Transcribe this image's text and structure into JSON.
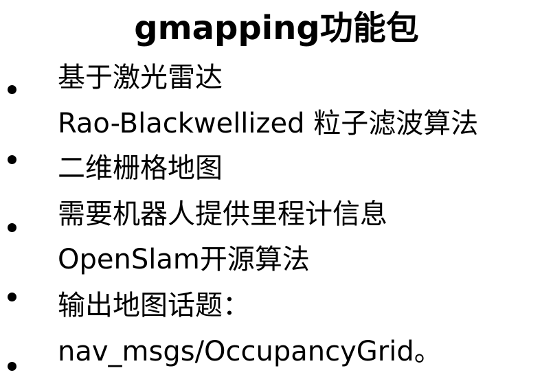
{
  "slide": {
    "title": "gmapping功能包",
    "lines": [
      "基于激光雷达",
      "Rao-Blackwellized 粒子滤波算法",
      "二维栅格地图",
      "需要机器人提供里程计信息",
      "OpenSlam开源算法",
      "输出地图话题：",
      "nav_msgs/OccupancyGrid。"
    ],
    "bullet_count": 5,
    "colors": {
      "background": "#ffffff",
      "text": "#000000"
    }
  }
}
